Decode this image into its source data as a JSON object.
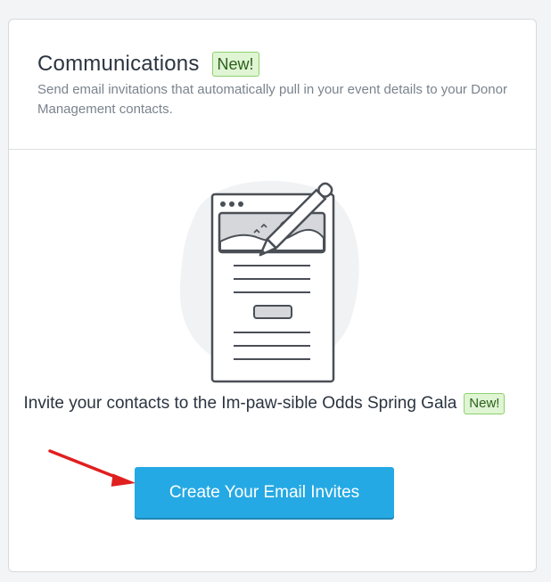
{
  "header": {
    "title": "Communications",
    "badge": "New!",
    "subtitle": "Send email invitations that automatically pull in your event details to your Donor Management contacts."
  },
  "main": {
    "invite_text": "Invite your contacts to the Im-paw-sible Odds Spring Gala",
    "invite_badge": "New!",
    "cta_label": "Create Your Email Invites"
  },
  "icons": {
    "illustration": "email-document-with-pencil-illustration",
    "arrow": "red-pointer-arrow-icon"
  },
  "colors": {
    "accent": "#25a9e4",
    "badge_bg": "#dff5d3",
    "badge_border": "#8fd16e",
    "arrow": "#e01f1f"
  }
}
